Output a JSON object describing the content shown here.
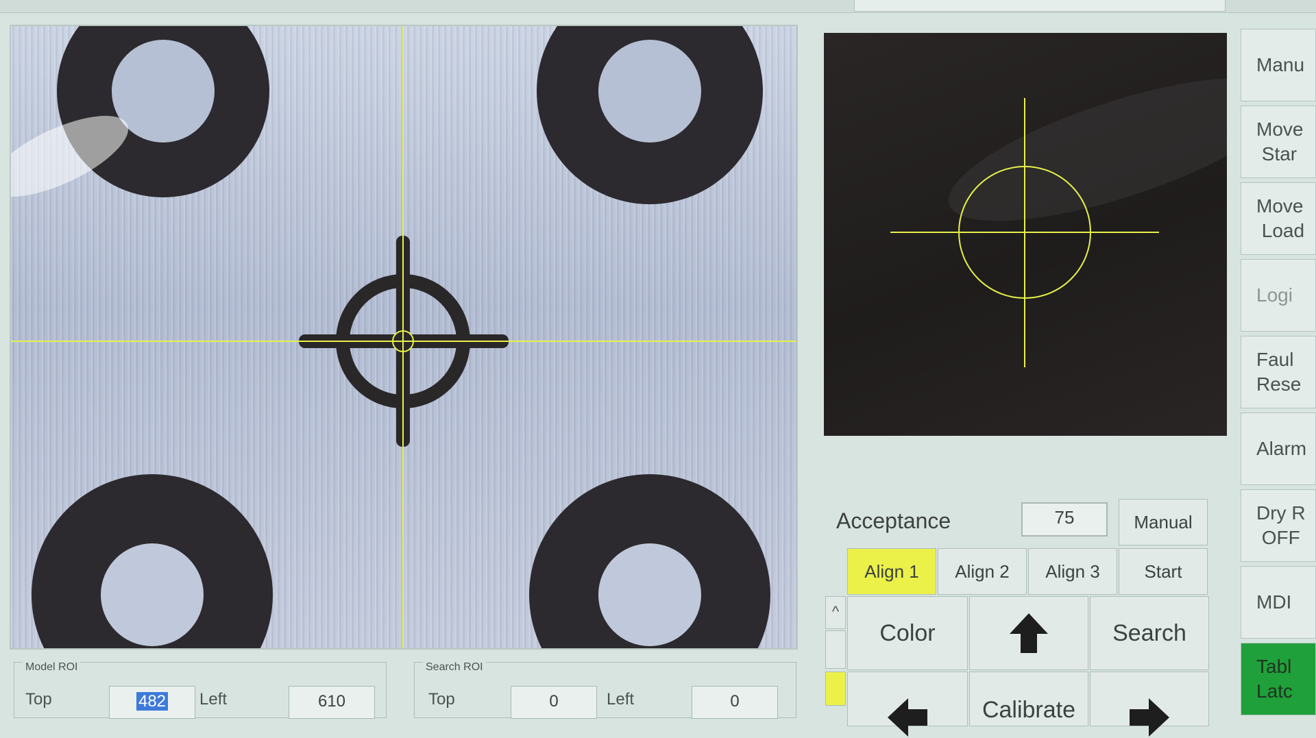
{
  "acceptance": {
    "label": "Acceptance",
    "value": "75",
    "manual_label": "Manual"
  },
  "align_tabs": [
    {
      "label": "Align 1",
      "active": true
    },
    {
      "label": "Align 2",
      "active": false
    },
    {
      "label": "Align 3",
      "active": false
    },
    {
      "label": "Start",
      "active": false
    }
  ],
  "jog": {
    "color_label": "Color",
    "search_label": "Search",
    "calibrate_label": "Calibrate",
    "up_icon": "arrow-up-icon",
    "left_icon": "arrow-left-icon",
    "right_icon": "arrow-right-icon"
  },
  "mini": {
    "up_glyph": "^"
  },
  "model_roi": {
    "title": "Model ROI",
    "top_label": "Top",
    "top_value": "482",
    "left_label": "Left",
    "left_value": "610"
  },
  "search_roi": {
    "title": "Search ROI",
    "top_label": "Top",
    "top_value": "0",
    "left_label": "Left",
    "left_value": "0"
  },
  "sidebar": [
    {
      "label": "Manu",
      "style": "normal"
    },
    {
      "label": "Move\n Star",
      "style": "normal"
    },
    {
      "label": "Move\n Load",
      "style": "normal"
    },
    {
      "label": "Logi",
      "style": "dim"
    },
    {
      "label": "Faul\nRese",
      "style": "normal"
    },
    {
      "label": "Alarm",
      "style": "normal"
    },
    {
      "label": "Dry R\n OFF",
      "style": "normal"
    },
    {
      "label": "MDI",
      "style": "normal"
    },
    {
      "label": "Tabl\nLatc",
      "style": "green"
    }
  ],
  "colors": {
    "accent_yellow": "#ecf14a",
    "table_latch_green": "#1fa03a",
    "crosshair": "#e6f24a"
  }
}
